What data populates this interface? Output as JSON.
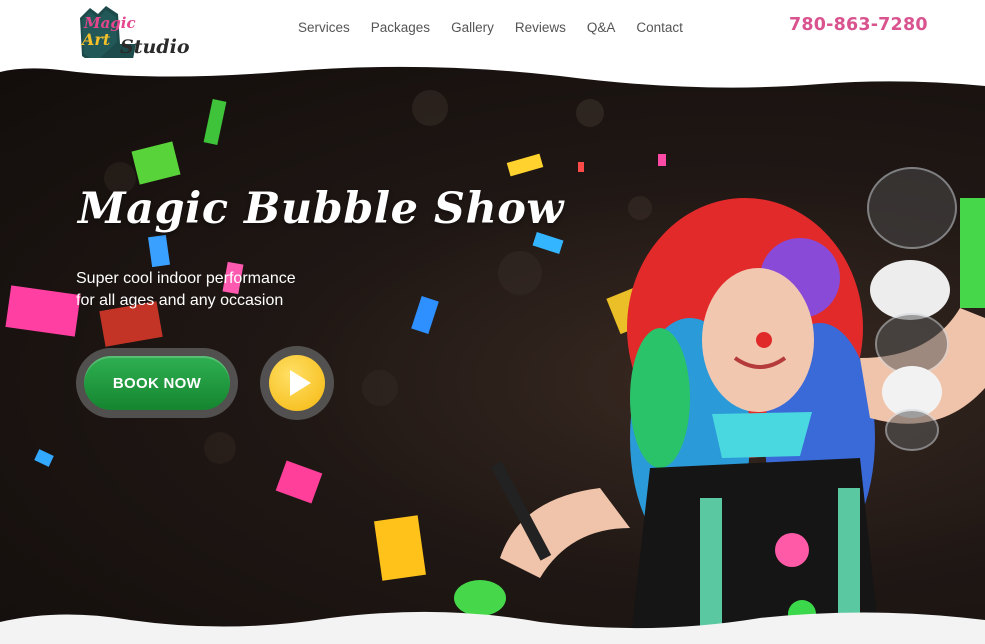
{
  "logo": {
    "line1": "Magic",
    "line2": "Art",
    "line3": "Studio",
    "icon": "logo-badge-icon"
  },
  "nav": {
    "items": [
      {
        "label": "Services"
      },
      {
        "label": "Packages"
      },
      {
        "label": "Gallery"
      },
      {
        "label": "Reviews"
      },
      {
        "label": "Q&A"
      },
      {
        "label": "Contact"
      }
    ]
  },
  "phone": "780-863-7280",
  "hero": {
    "title": "Magic Bubble Show",
    "subtitle_line1": "Super cool indoor performance",
    "subtitle_line2": "for all ages and any occasion",
    "book_label": "BOOK NOW",
    "play_icon": "play-icon"
  },
  "colors": {
    "accent_pink": "#d9548f",
    "button_green": "#1e9a3e",
    "play_yellow": "#f5b70e",
    "hero_bg": "#1f1714"
  }
}
